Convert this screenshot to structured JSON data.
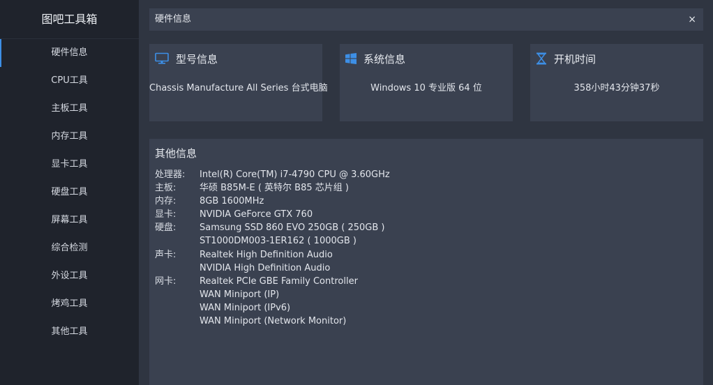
{
  "app": {
    "title": "图吧工具箱"
  },
  "sidebar": {
    "items": [
      {
        "label": "硬件信息",
        "active": true
      },
      {
        "label": "CPU工具"
      },
      {
        "label": "主板工具"
      },
      {
        "label": "内存工具"
      },
      {
        "label": "显卡工具"
      },
      {
        "label": "硬盘工具"
      },
      {
        "label": "屏幕工具"
      },
      {
        "label": "综合检测"
      },
      {
        "label": "外设工具"
      },
      {
        "label": "烤鸡工具"
      },
      {
        "label": "其他工具"
      }
    ]
  },
  "tab": {
    "label": "硬件信息",
    "close": "×"
  },
  "cards": {
    "model": {
      "title": "型号信息",
      "value": "Chassis Manufacture All Series 台式电脑",
      "icon": "monitor-icon"
    },
    "system": {
      "title": "系统信息",
      "value": "Windows 10 专业版 64 位",
      "icon": "windows-icon"
    },
    "uptime": {
      "title": "开机时间",
      "value": "358小时43分钟37秒",
      "icon": "hourglass-icon"
    }
  },
  "other": {
    "title": "其他信息",
    "rows": [
      {
        "key": "处理器:",
        "value": "Intel(R) Core(TM) i7-4790 CPU @ 3.60GHz"
      },
      {
        "key": "主板:",
        "value": "华硕 B85M-E ( 英特尔 B85 芯片组 )"
      },
      {
        "key": "内存:",
        "value": "8GB 1600MHz"
      },
      {
        "key": "显卡:",
        "value": "NVIDIA GeForce GTX 760"
      },
      {
        "key": "硬盘:",
        "value": "Samsung SSD 860 EVO 250GB ( 250GB )"
      },
      {
        "key": "",
        "value": "ST1000DM003-1ER162 ( 1000GB )"
      },
      {
        "key": "声卡:",
        "value": "Realtek High Definition Audio"
      },
      {
        "key": "",
        "value": "NVIDIA High Definition Audio"
      },
      {
        "key": "网卡:",
        "value": "Realtek PCIe GBE Family Controller"
      },
      {
        "key": "",
        "value": "WAN Miniport (IP)"
      },
      {
        "key": "",
        "value": "WAN Miniport (IPv6)"
      },
      {
        "key": "",
        "value": "WAN Miniport (Network Monitor)"
      }
    ]
  },
  "colors": {
    "accent": "#3d8fe6",
    "sidebar_bg": "#1f232c",
    "main_bg": "#2f3541",
    "card_bg": "#3a4150"
  }
}
